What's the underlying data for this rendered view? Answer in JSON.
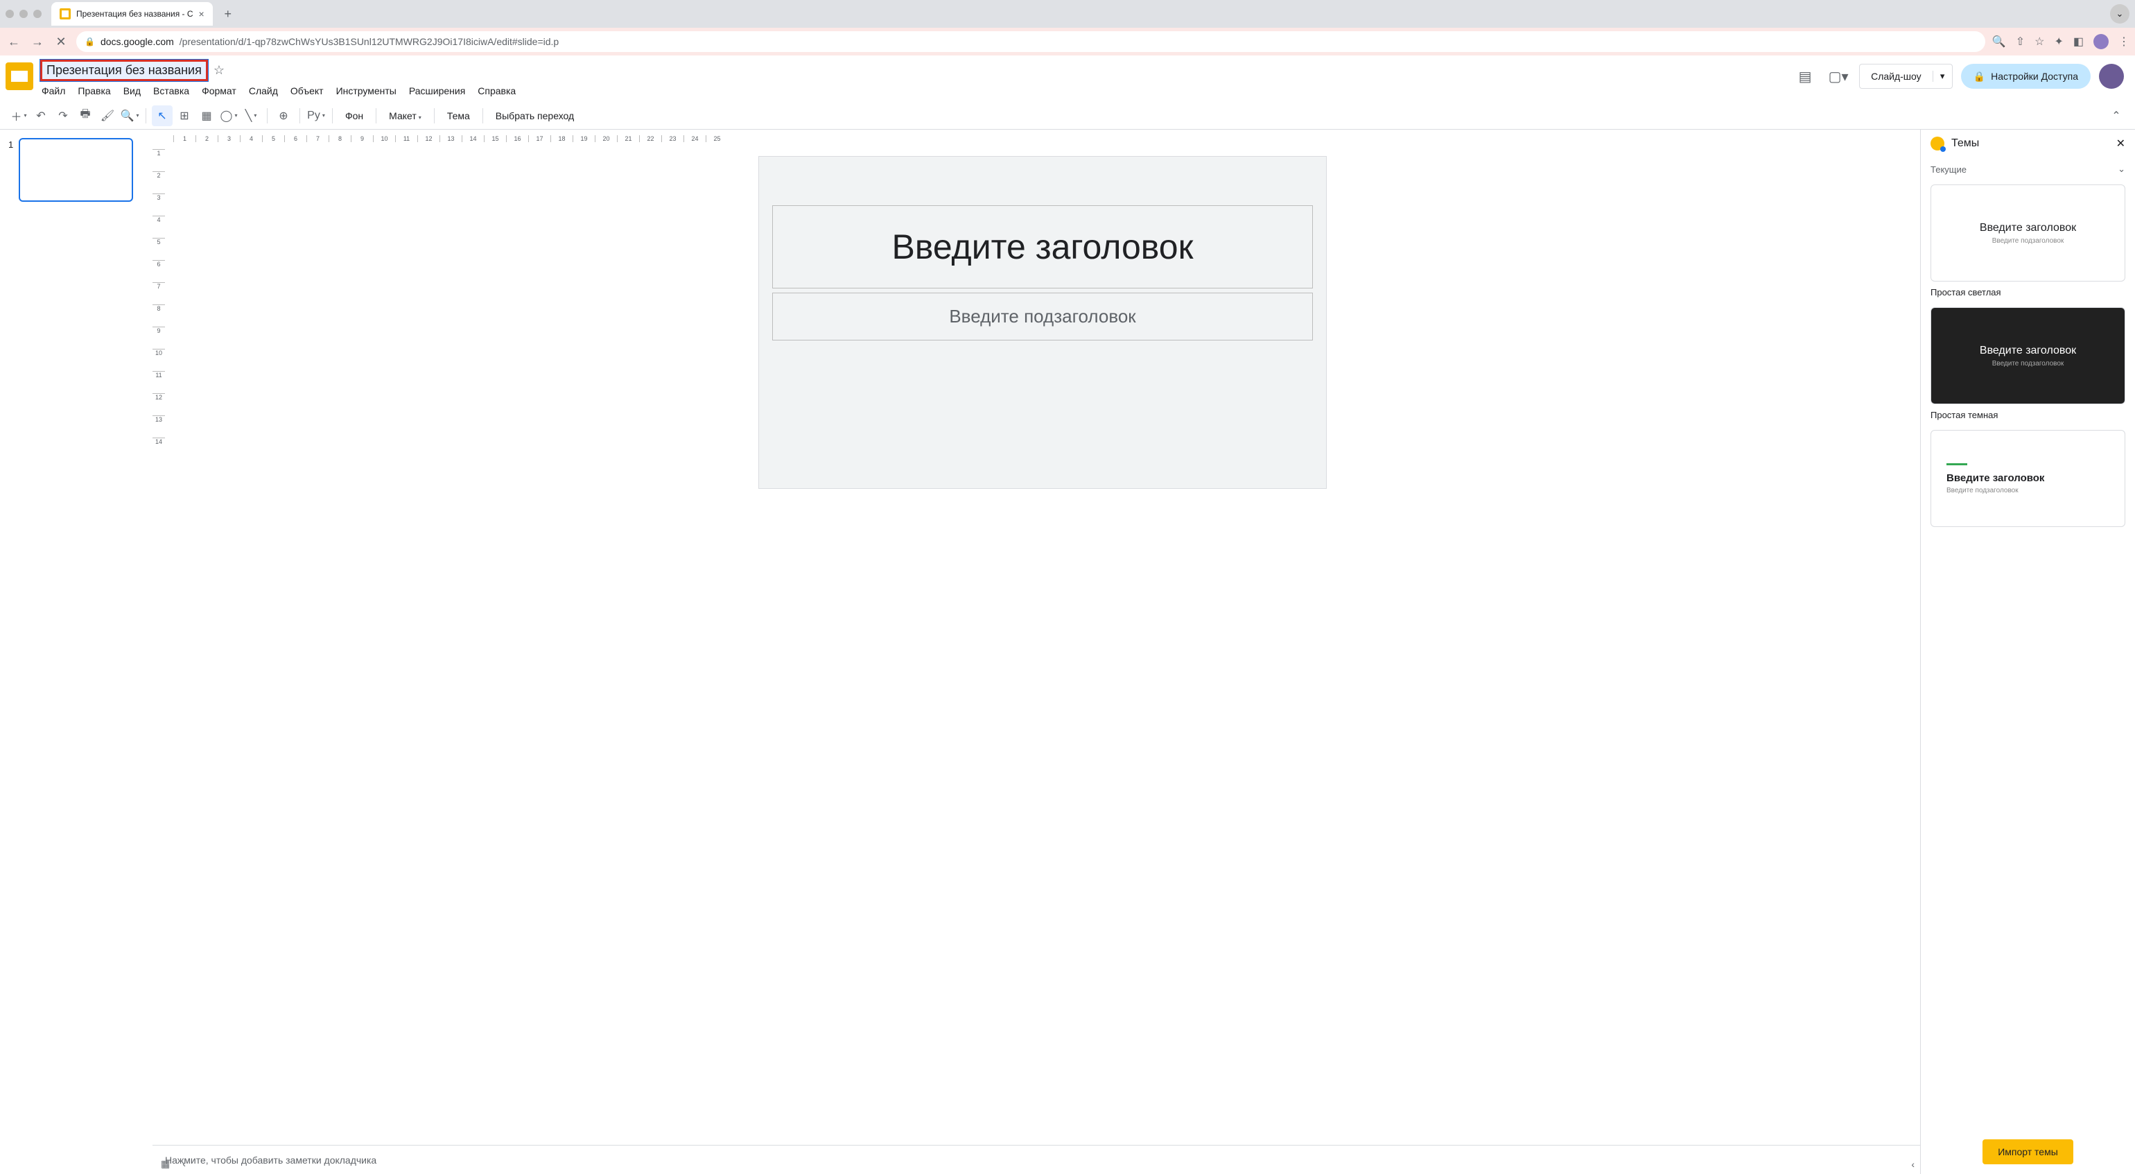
{
  "browser": {
    "tab_title": "Презентация без названия - С",
    "url_host": "docs.google.com",
    "url_path": "/presentation/d/1-qp78zwChWsYUs3B1SUnl12UTMWRG2J9Oi17I8iciwA/edit#slide=id.p"
  },
  "header": {
    "doc_title": "Презентация без названия",
    "menu": [
      "Файл",
      "Правка",
      "Вид",
      "Вставка",
      "Формат",
      "Слайд",
      "Объект",
      "Инструменты",
      "Расширения",
      "Справка"
    ],
    "slideshow_label": "Слайд-шоу",
    "share_label": "Настройки Доступа"
  },
  "toolbar": {
    "background_label": "Фон",
    "layout_label": "Макет",
    "theme_label": "Тема",
    "transition_label": "Выбрать переход",
    "format_label": "Pу"
  },
  "filmstrip": {
    "slide_number": "1"
  },
  "canvas": {
    "title_placeholder": "Введите заголовок",
    "subtitle_placeholder": "Введите подзаголовок",
    "ruler_h": [
      "1",
      "2",
      "3",
      "4",
      "5",
      "6",
      "7",
      "8",
      "9",
      "10",
      "11",
      "12",
      "13",
      "14",
      "15",
      "16",
      "17",
      "18",
      "19",
      "20",
      "21",
      "22",
      "23",
      "24",
      "25"
    ],
    "ruler_v": [
      "1",
      "2",
      "3",
      "4",
      "5",
      "6",
      "7",
      "8",
      "9",
      "10",
      "11",
      "12",
      "13",
      "14"
    ]
  },
  "themes": {
    "panel_title": "Темы",
    "current_label": "Текущие",
    "cards": [
      {
        "title": "Введите заголовок",
        "subtitle": "Введите подзаголовок",
        "label": "Простая светлая"
      },
      {
        "title": "Введите заголовок",
        "subtitle": "Введите подзаголовок",
        "label": "Простая темная"
      },
      {
        "title": "Введите заголовок",
        "subtitle": "Введите подзаголовок",
        "label": ""
      }
    ],
    "import_label": "Импорт темы"
  },
  "notes": {
    "placeholder": "Нажмите, чтобы добавить заметки докладчика"
  }
}
